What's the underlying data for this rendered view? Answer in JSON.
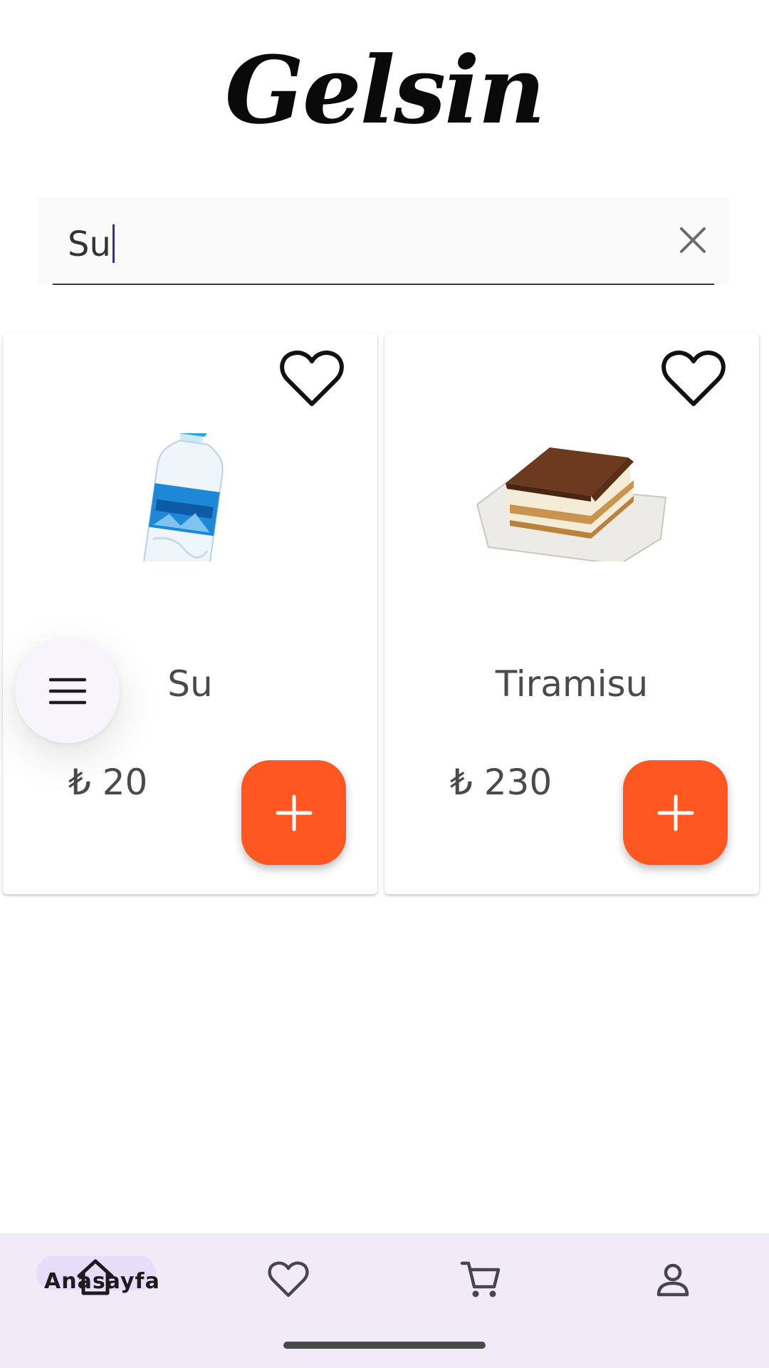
{
  "app": {
    "logo_text": "Gelsin"
  },
  "search": {
    "value": "Su",
    "clear_icon": "close-icon"
  },
  "products": [
    {
      "name": "Su",
      "price": "₺ 20",
      "image": "water-bottle",
      "favorite_icon": "heart-outline-icon",
      "add_icon": "plus-icon"
    },
    {
      "name": "Tiramisu",
      "price": "₺ 230",
      "image": "tiramisu-cake",
      "favorite_icon": "heart-outline-icon",
      "add_icon": "plus-icon"
    }
  ],
  "menu_button": {
    "icon": "hamburger-menu-icon"
  },
  "bottom_nav": {
    "items": [
      {
        "label": "Anasayfa",
        "icon": "home-icon",
        "active": true
      },
      {
        "label": "",
        "icon": "heart-outline-icon",
        "active": false
      },
      {
        "label": "",
        "icon": "cart-icon",
        "active": false
      },
      {
        "label": "",
        "icon": "person-icon",
        "active": false
      }
    ]
  },
  "colors": {
    "accent": "#ff5722",
    "nav_background": "#f1ebf7",
    "nav_active_pill": "#e7ddf8",
    "text": "#4a4a4a"
  }
}
